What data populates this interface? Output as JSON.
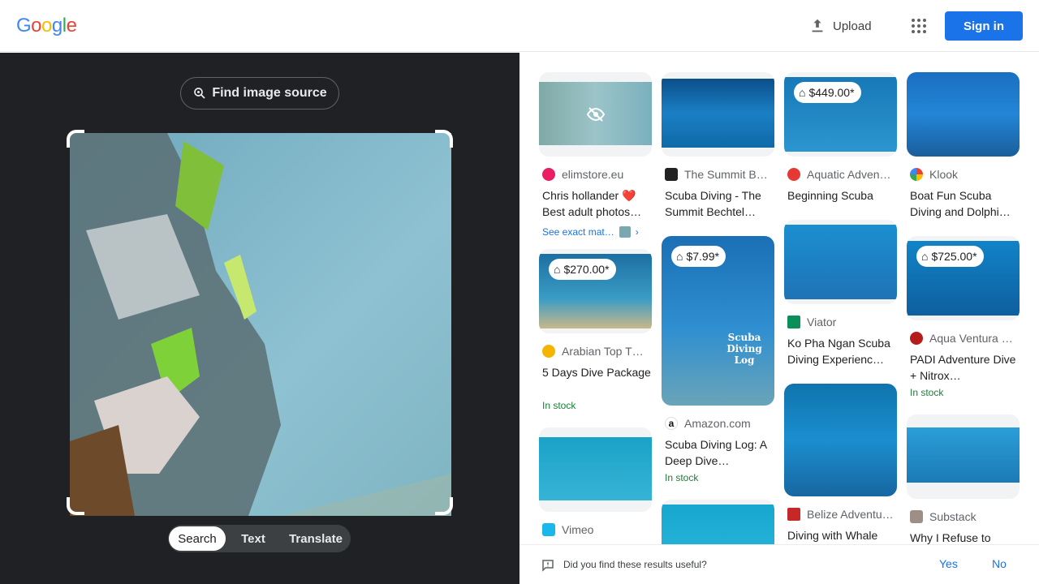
{
  "header": {
    "logo_letters": [
      "G",
      "o",
      "o",
      "g",
      "l",
      "e"
    ],
    "logo_colors": [
      "#4285F4",
      "#EA4335",
      "#FBBC05",
      "#4285F4",
      "#34A853",
      "#EA4335"
    ],
    "upload_label": "Upload",
    "signin_label": "Sign in"
  },
  "left": {
    "find_source_label": "Find image source",
    "modes": [
      "Search",
      "Text",
      "Translate"
    ],
    "active_mode": "Search"
  },
  "results": {
    "col1": [
      {
        "source": "elimstore.eu",
        "title": "Chris hollander ❤️ Best adult photos…",
        "exact_label": "See exact mat…",
        "hidden": true
      },
      {
        "price": "$270.00*",
        "source": "Arabian Top T…",
        "title": "5 Days Dive Package",
        "stock": "In stock"
      },
      {
        "source": "Vimeo",
        "title": ""
      }
    ],
    "col2": [
      {
        "source": "The Summit B…",
        "title": "Scuba Diving - The Summit Bechtel…"
      },
      {
        "price": "$7.99*",
        "source": "Amazon.com",
        "title": "Scuba Diving Log: A Deep Dive…",
        "stock": "In stock",
        "cover_text": "Scuba Diving Log"
      },
      {
        "source": "",
        "title": ""
      }
    ],
    "col3": [
      {
        "price": "$449.00*",
        "source": "Aquatic Adven…",
        "title": "Beginning Scuba"
      },
      {
        "source": "Viator",
        "title": "Ko Pha Ngan Scuba Diving Experienc…"
      },
      {
        "source": "Belize Adventu…",
        "title": "Diving with Whale"
      }
    ],
    "col4": [
      {
        "source": "Klook",
        "title": "Boat Fun Scuba Diving and Dolphi…"
      },
      {
        "price": "$725.00*",
        "source": "Aqua Ventura …",
        "title": "PADI Adventure Dive + Nitrox…",
        "stock": "In stock"
      },
      {
        "source": "Substack",
        "title": "Why I Refuse to"
      }
    ]
  },
  "feedback": {
    "question": "Did you find these results useful?",
    "yes_label": "Yes",
    "no_label": "No"
  }
}
